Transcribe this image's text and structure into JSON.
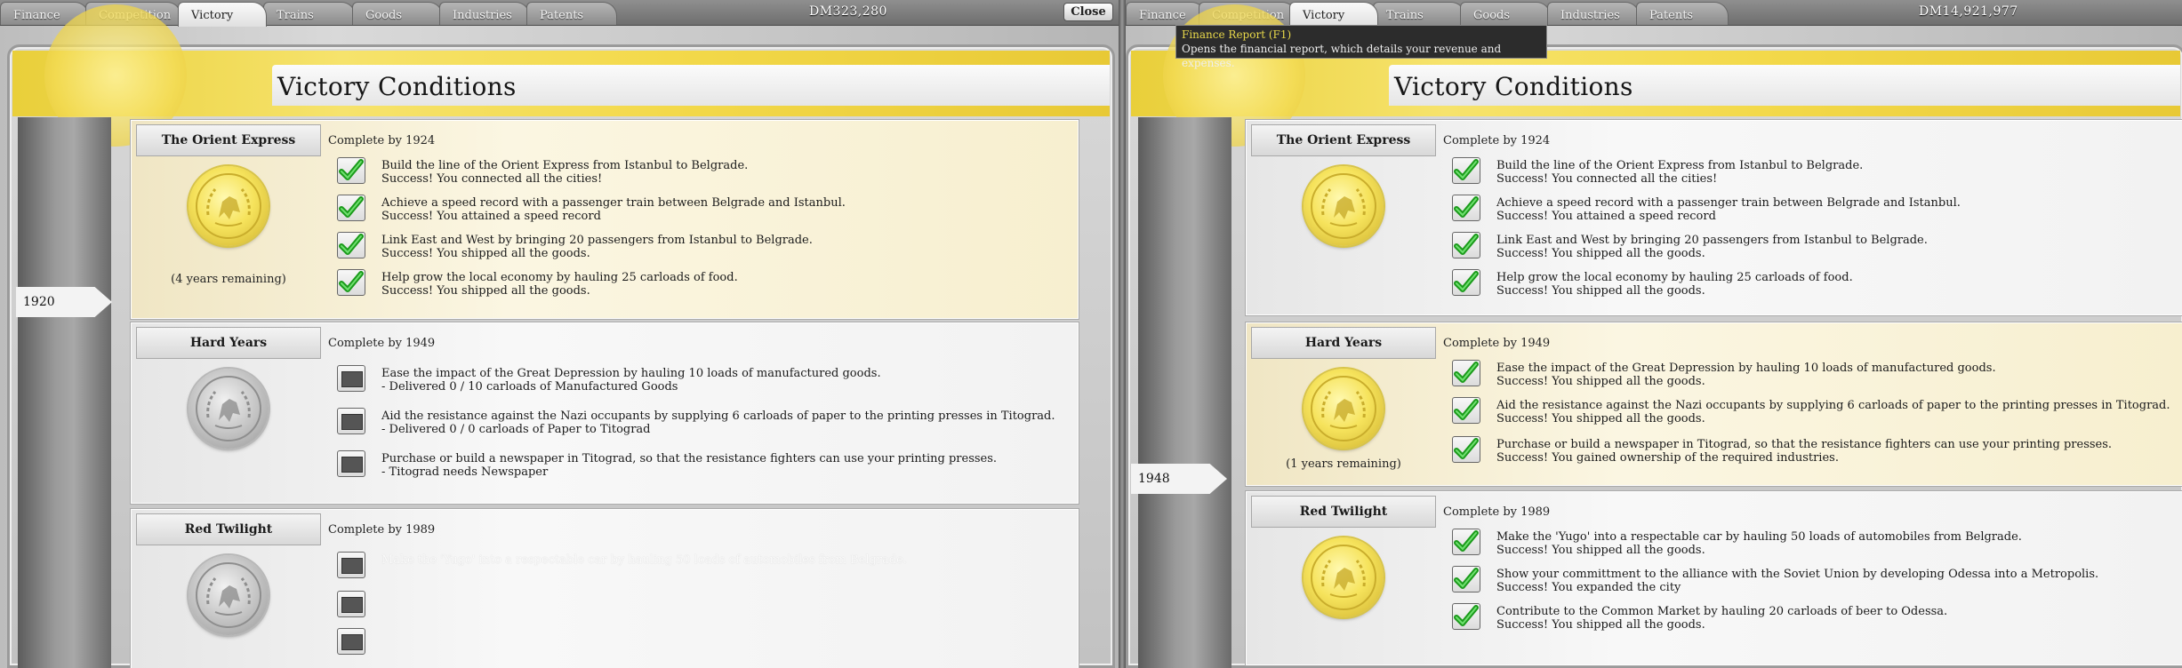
{
  "left": {
    "tabs": [
      "Finance",
      "Competition",
      "Victory",
      "Trains",
      "Goods",
      "Industries",
      "Patents"
    ],
    "active_tab": "Victory",
    "money": "DM323,280",
    "close_label": "Close",
    "title": "Victory Conditions",
    "timeline_year": "1920",
    "scenarios": [
      {
        "name": "The Orient Express",
        "complete_by": "Complete by 1924",
        "medal": "gold",
        "remaining": "(4 years remaining)",
        "goals": [
          {
            "done": true,
            "text": "Build the line of the Orient Express from Istanbul to Belgrade.",
            "status": "Success! You connected all the cities!"
          },
          {
            "done": true,
            "text": "Achieve a speed record with a passenger train between Belgrade and Istanbul.",
            "status": "Success! You attained a speed record"
          },
          {
            "done": true,
            "text": "Link East and West by bringing 20 passengers from Istanbul to Belgrade.",
            "status": "Success! You shipped all the goods."
          },
          {
            "done": true,
            "text": "Help grow the local economy by hauling 25 carloads of food.",
            "status": "Success! You shipped all the goods."
          }
        ]
      },
      {
        "name": "Hard Years",
        "complete_by": "Complete by 1949",
        "medal": "silver",
        "remaining": "",
        "goals": [
          {
            "done": false,
            "text": "Ease the impact of the Great Depression by hauling 10 loads of manufactured goods.",
            "status": "- Delivered 0 / 10 carloads of Manufactured Goods"
          },
          {
            "done": false,
            "text": "Aid the resistance against the Nazi occupants by supplying 6 carloads of paper to the printing presses in Titograd.",
            "status": "- Delivered 0 / 0 carloads of Paper to Titograd"
          },
          {
            "done": false,
            "text": "Purchase or build a newspaper in Titograd, so that the resistance fighters can use your printing presses.",
            "status": "- Titograd needs Newspaper"
          }
        ]
      },
      {
        "name": "Red Twilight",
        "complete_by": "Complete by 1989",
        "medal": "silver",
        "remaining": "",
        "goals": [
          {
            "done": false,
            "text": "Make the 'Yugo' into a respectable car by hauling 50 loads of automobiles from Belgrade.",
            "status": ""
          },
          {
            "done": false,
            "text": "",
            "status": ""
          },
          {
            "done": false,
            "text": "",
            "status": ""
          }
        ]
      }
    ]
  },
  "right": {
    "tabs": [
      "Finance",
      "Competition",
      "Victory",
      "Trains",
      "Goods",
      "Industries",
      "Patents"
    ],
    "active_tab": "Victory",
    "money": "DM14,921,977",
    "tooltip": {
      "title": "Finance Report (F1)",
      "body": "Opens the financial report, which details your revenue and expenses."
    },
    "title": "Victory Conditions",
    "timeline_year": "1948",
    "scenarios": [
      {
        "name": "The Orient Express",
        "complete_by": "Complete by 1924",
        "medal": "gold",
        "remaining": "",
        "goals": [
          {
            "done": true,
            "text": "Build the line of the Orient Express from Istanbul to Belgrade.",
            "status": "Success! You connected all the cities!"
          },
          {
            "done": true,
            "text": "Achieve a speed record with a passenger train between Belgrade and Istanbul.",
            "status": "Success! You attained a speed record"
          },
          {
            "done": true,
            "text": "Link East and West by bringing 20 passengers from Istanbul to Belgrade.",
            "status": "Success! You shipped all the goods."
          },
          {
            "done": true,
            "text": "Help grow the local economy by hauling 25 carloads of food.",
            "status": "Success! You shipped all the goods."
          }
        ]
      },
      {
        "name": "Hard Years",
        "complete_by": "Complete by 1949",
        "medal": "gold",
        "remaining": "(1 years remaining)",
        "goals": [
          {
            "done": true,
            "text": "Ease the impact of the Great Depression by hauling 10 loads of manufactured goods.",
            "status": "Success! You shipped all the goods."
          },
          {
            "done": true,
            "text": "Aid the resistance against the Nazi occupants by supplying 6 carloads of paper to the printing presses in Titograd.",
            "status": "Success! You shipped all the goods."
          },
          {
            "done": true,
            "text": "Purchase or build a newspaper in Titograd, so that the resistance fighters can use your printing presses.",
            "status": "Success! You gained ownership of the required industries."
          }
        ]
      },
      {
        "name": "Red Twilight",
        "complete_by": "Complete by 1989",
        "medal": "gold",
        "remaining": "",
        "goals": [
          {
            "done": true,
            "text": "Make the 'Yugo' into a respectable car by hauling 50 loads of automobiles from Belgrade.",
            "status": "Success! You shipped all the goods."
          },
          {
            "done": true,
            "text": "Show your committment to the alliance with the Soviet Union by developing Odessa into a Metropolis.",
            "status": "Success! You expanded the city"
          },
          {
            "done": true,
            "text": "Contribute to the Common Market by hauling 20 carloads of beer to Odessa.",
            "status": "Success! You shipped all the goods."
          }
        ]
      }
    ]
  }
}
